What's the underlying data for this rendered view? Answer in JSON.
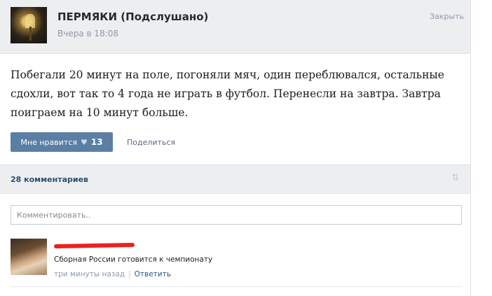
{
  "post": {
    "group_name": "ПЕРМЯКИ (Подслушано)",
    "time": "Вчера в 18:08",
    "close_label": "Закрыть",
    "text": "Побегали 20 минут на поле, погоняли мяч, один переблювался, остальные сдохли, вот так то 4 года не играть в футбол. Перенесли на завтра. Завтра поиграем на 10 минут больше."
  },
  "actions": {
    "like_label": "Мне нравится",
    "like_icon": "heart-icon",
    "like_count": "13",
    "share_label": "Поделиться"
  },
  "comments": {
    "count_label": "28 комментариев",
    "sort_icon": "sort-arrows-icon",
    "input_placeholder": "Комментировать..",
    "items": [
      {
        "text": "Сборная России готовится к чемпионату",
        "time": "три минуты назад",
        "reply_label": "Ответить"
      }
    ]
  },
  "colors": {
    "accent": "#5b7ea5",
    "link": "#2b587a",
    "redaction": "#e8231f"
  }
}
